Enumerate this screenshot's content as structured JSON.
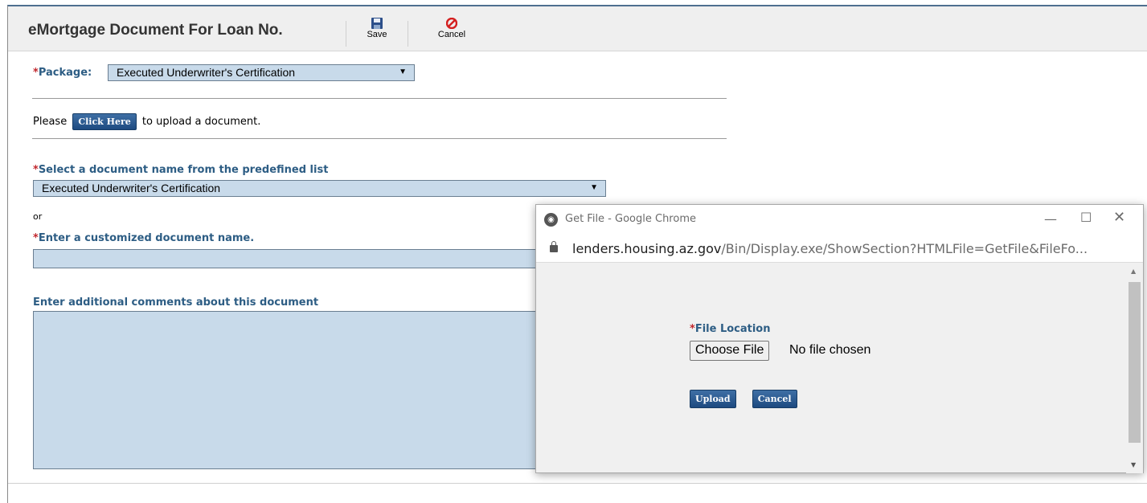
{
  "header": {
    "title": "eMortgage Document For Loan No.",
    "save_label": "Save",
    "cancel_label": "Cancel"
  },
  "form": {
    "package_label": "Package:",
    "package_value": "Executed Underwriter's Certification",
    "upload_prefix": "Please",
    "click_here_label": "Click Here",
    "upload_suffix": "to upload a document.",
    "predefined_label": "Select a document name from the predefined list",
    "predefined_value": "Executed Underwriter's Certification",
    "or_label": "or",
    "custom_name_label": "Enter a customized document name.",
    "custom_name_value": "",
    "comments_label": "Enter additional comments about this document",
    "comments_value": "",
    "required_mark": "*"
  },
  "popup": {
    "window_title": "Get File - Google Chrome",
    "url_host": "lenders.housing.az.gov",
    "url_path": "/Bin/Display.exe/ShowSection?HTMLFile=GetFile&FileFo...",
    "file_location_label": "File Location",
    "choose_file_label": "Choose File",
    "no_file_text": "No file chosen",
    "upload_label": "Upload",
    "cancel_label": "Cancel"
  },
  "icons": {
    "save": "floppy-disk-icon",
    "cancel": "no-entry-icon",
    "globe": "globe-icon",
    "lock": "lock-icon"
  },
  "colors": {
    "label_blue": "#2d5d84",
    "required_red": "#c1272d",
    "field_bg": "#c8daea",
    "button_blue": "#1d4a80"
  }
}
